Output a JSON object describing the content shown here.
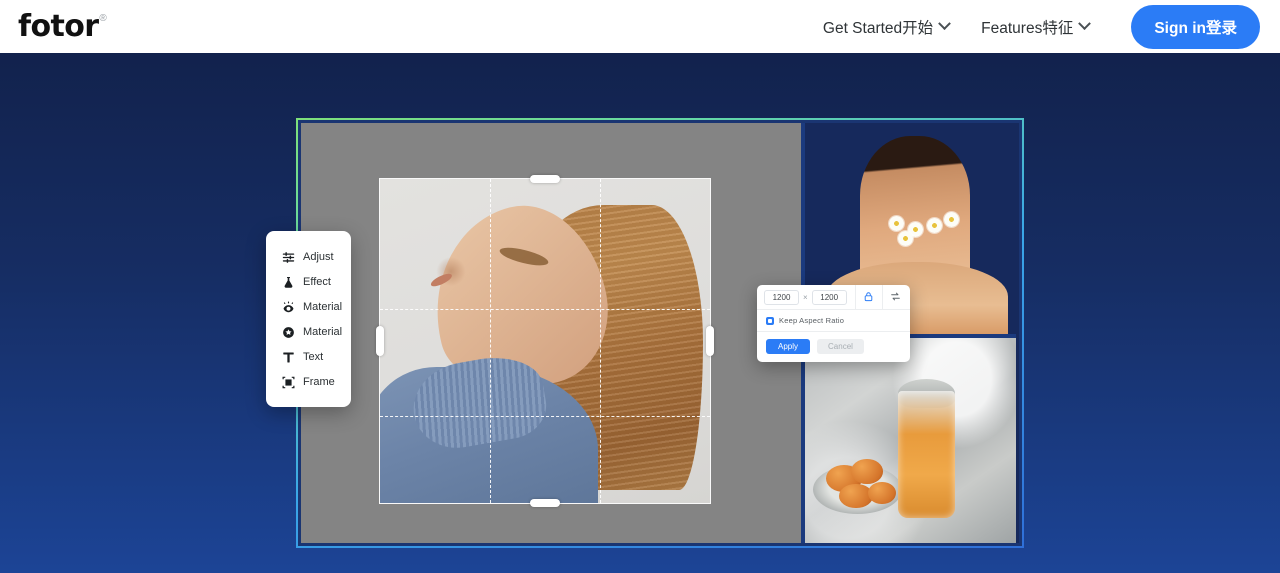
{
  "header": {
    "logo": {
      "text": "fotor",
      "trademark": "®"
    },
    "nav": [
      {
        "label": "Get Started开始",
        "icon": "chevron-down-icon"
      },
      {
        "label": "Features特征",
        "icon": "chevron-down-icon"
      }
    ],
    "signin_label": "Sign in登录",
    "accent_color": "#2b7cf6"
  },
  "tool_menu": {
    "items": [
      {
        "label": "Adjust",
        "icon": "sliders-icon"
      },
      {
        "label": "Effect",
        "icon": "flask-icon"
      },
      {
        "label": "Material",
        "icon": "eye-rays-icon"
      },
      {
        "label": "Material",
        "icon": "flower-badge-icon"
      },
      {
        "label": "Text",
        "icon": "text-t-icon"
      },
      {
        "label": "Frame",
        "icon": "frame-icon"
      }
    ]
  },
  "resize_dialog": {
    "width_value": "1200",
    "height_value": "1200",
    "width_placeholder": "1200",
    "height_placeholder": "1200",
    "separator": "×",
    "lock_icon": "lock-icon",
    "swap_icon": "swap-arrows-icon",
    "keep_aspect_label": "Keep Aspect Ratio",
    "keep_aspect_checked": true,
    "apply_label": "Apply",
    "cancel_label": "Cancel",
    "apply_color": "#2b7cf6",
    "cancel_color": "#eceef0"
  },
  "canvas": {
    "main_photo": "woman-tilting-head-blue-turtleneck",
    "thumbnails": [
      {
        "name": "woman-with-sunflowers-and-daisies"
      },
      {
        "name": "orange-drink-in-glass-with-foil"
      }
    ],
    "crop_guides": "rule-of-thirds",
    "frame_border_gradient": "#7ee07a → #2f6fd8"
  },
  "background": {
    "gradient_top": "#12224d",
    "gradient_bottom": "#1c4496"
  }
}
